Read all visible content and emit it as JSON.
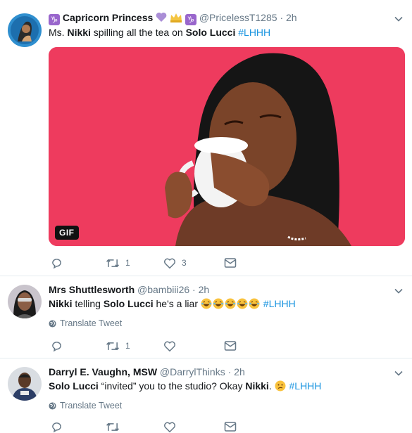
{
  "tweets": [
    {
      "name": "Capricorn Princess",
      "handle": "@PricelessT1285",
      "time": "2h",
      "text": {
        "p1": "Ms. ",
        "b1": "Nikki",
        "p2": " spilling all the tea on ",
        "b2": "Solo Lucci",
        "p3": " ",
        "hashtag": "#LHHH"
      },
      "media_badge": "GIF",
      "retweets": "1",
      "likes": "3"
    },
    {
      "name": "Mrs Shuttlesworth",
      "handle": "@bambiii26",
      "time": "2h",
      "text": {
        "b1": "Nikki",
        "p1": " telling ",
        "b2": "Solo Lucci",
        "p2": " he's a liar ",
        "hashtag": "#LHHH"
      },
      "translate": "Translate Tweet",
      "retweets": "1",
      "likes": ""
    },
    {
      "name": "Darryl E. Vaughn, MSW",
      "handle": "@DarrylThinks",
      "time": "2h",
      "text": {
        "b1": "Solo Lucci",
        "p1": " “invited” you to the studio? Okay ",
        "b2": "Nikki",
        "p2": ". ",
        "hashtag": "#LHHH"
      },
      "translate": "Translate Tweet"
    }
  ],
  "separator": "·",
  "colors": {
    "link": "#1b95e0",
    "muted": "#657786",
    "gif_background": "#ee3b5e",
    "divider": "#e6ecf0"
  },
  "icons": [
    "reply-icon",
    "retweet-icon",
    "heart-icon",
    "dm-icon",
    "chevron-down-icon",
    "globe-icon",
    "emoji-laugh-icon",
    "emoji-confused-icon"
  ]
}
